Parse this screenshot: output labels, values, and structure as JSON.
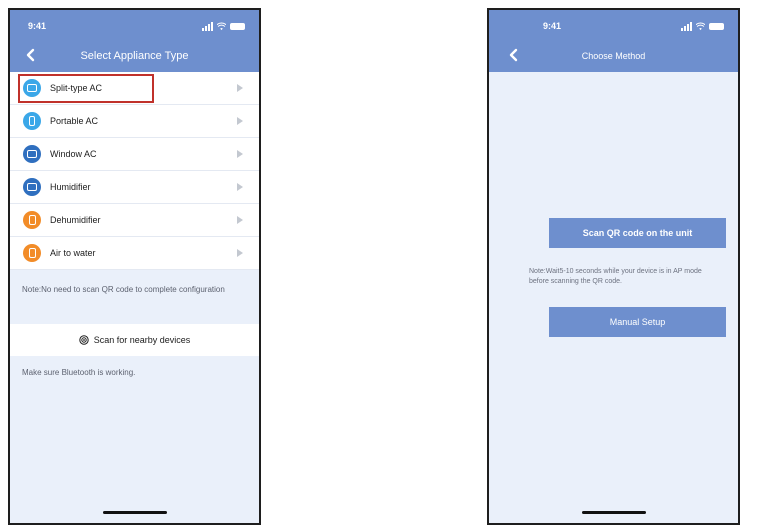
{
  "left_screen": {
    "status": {
      "time": "9:41"
    },
    "nav": {
      "title": "Select Appliance Type",
      "back_icon": "chevron-left-icon"
    },
    "appliances": [
      {
        "label": "Split-type AC",
        "color": "#3aa7e8",
        "icon": "ac-unit-icon",
        "highlighted": true
      },
      {
        "label": "Portable AC",
        "color": "#3aa7e8",
        "icon": "portable-ac-icon",
        "highlighted": false
      },
      {
        "label": "Window AC",
        "color": "#2f6fbf",
        "icon": "window-ac-icon",
        "highlighted": false
      },
      {
        "label": "Humidifier",
        "color": "#2f6fbf",
        "icon": "humidifier-icon",
        "highlighted": false
      },
      {
        "label": "Dehumidifier",
        "color": "#f28c28",
        "icon": "dehumidifier-icon",
        "highlighted": false
      },
      {
        "label": "Air to water",
        "color": "#f28c28",
        "icon": "air-to-water-icon",
        "highlighted": false
      }
    ],
    "note": "Note:No need to scan QR code to complete configuration",
    "scan_nearby_label": "Scan for nearby devices",
    "bluetooth_hint": "Make sure Bluetooth is working."
  },
  "right_screen": {
    "status": {
      "time": "9:41"
    },
    "nav": {
      "title": "Choose Method",
      "back_icon": "chevron-left-icon"
    },
    "scan_qr_label": "Scan QR code on the unit",
    "note": "Note:Wait5-10 seconds while your device is in AP mode before scanning the QR code.",
    "manual_setup_label": "Manual Setup"
  },
  "colors": {
    "header": "#6e8fce",
    "highlight_border": "#c0312b",
    "screen_bg": "#eaf0fa"
  }
}
